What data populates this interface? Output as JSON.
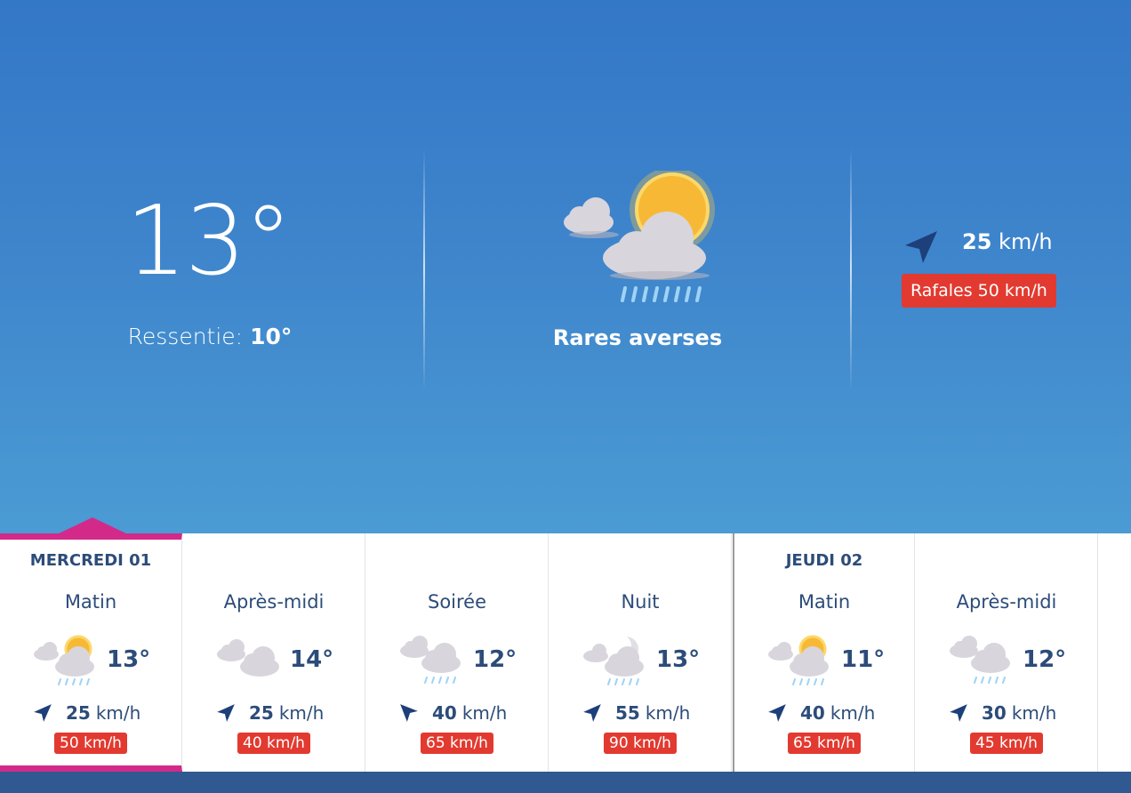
{
  "current": {
    "temperature": "13°",
    "feels_label": "Ressentie:",
    "feels_value": "10°",
    "condition": "Rares averses",
    "condition_icon": "sun-cloud-rain-icon",
    "wind_speed": "25",
    "wind_unit": "km/h",
    "gust": "Rafales 50 km/h"
  },
  "colors": {
    "hero_top": "#3377c7",
    "hero_bottom": "#4b9bd4",
    "text_dark": "#2c4c79",
    "gust_red": "#e23a30",
    "active_pink": "#d32a89",
    "footer": "#2f5990"
  },
  "forecast": [
    {
      "day": "MERCREDI 01",
      "period": "Matin",
      "icon": "sun-cloud-rain-icon",
      "temp": "13°",
      "wind": "25",
      "unit": "km/h",
      "gust": "50 km/h",
      "active": true
    },
    {
      "day": "",
      "period": "Après-midi",
      "icon": "clouds-icon",
      "temp": "14°",
      "wind": "25",
      "unit": "km/h",
      "gust": "40 km/h"
    },
    {
      "day": "",
      "period": "Soirée",
      "icon": "cloud-rain-icon",
      "temp": "12°",
      "wind": "40",
      "unit": "km/h",
      "gust": "65 km/h"
    },
    {
      "day": "",
      "period": "Nuit",
      "icon": "moon-cloud-rain-icon",
      "temp": "13°",
      "wind": "55",
      "unit": "km/h",
      "gust": "90 km/h"
    },
    {
      "day": "JEUDI 02",
      "period": "Matin",
      "icon": "sun-cloud-rain-icon",
      "temp": "11°",
      "wind": "40",
      "unit": "km/h",
      "gust": "65 km/h"
    },
    {
      "day": "",
      "period": "Après-midi",
      "icon": "cloud-rain-icon",
      "temp": "12°",
      "wind": "30",
      "unit": "km/h",
      "gust": "45 km/h"
    }
  ]
}
